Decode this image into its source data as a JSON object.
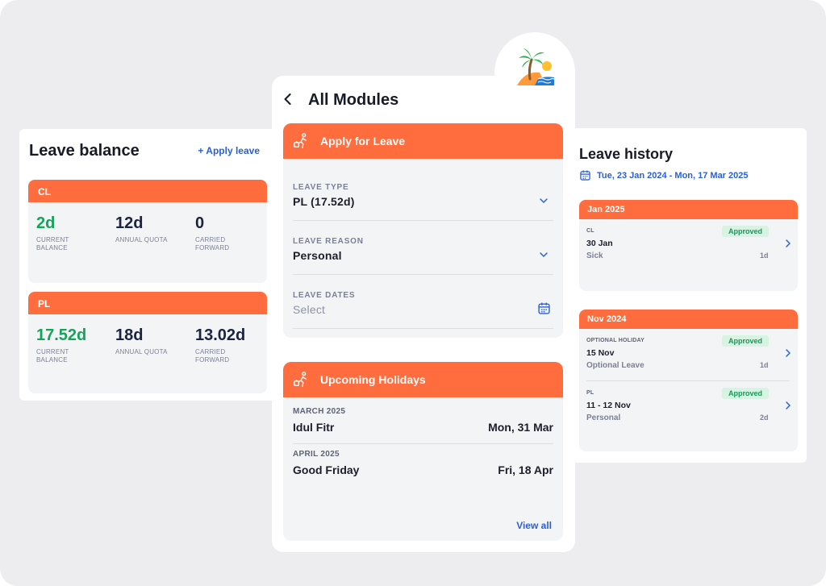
{
  "balance": {
    "title": "Leave balance",
    "apply_label": "+ Apply leave",
    "cards": [
      {
        "code": "CL",
        "current": "2d",
        "current_label": "CURRENT BALANCE",
        "quota": "12d",
        "quota_label": "ANNUAL QUOTA",
        "carried": "0",
        "carried_label": "CARRIED FORWARD"
      },
      {
        "code": "PL",
        "current": "17.52d",
        "current_label": "CURRENT BALANCE",
        "quota": "18d",
        "quota_label": "ANNUAL QUOTA",
        "carried": "13.02d",
        "carried_label": "CARRIED FORWARD"
      }
    ]
  },
  "modules": {
    "title": "All Modules",
    "back_icon": "chevron-left-icon",
    "badge_icon": "palm-beach-icon",
    "apply": {
      "header": "Apply for Leave",
      "icon": "person-luggage-icon",
      "fields": [
        {
          "label": "LEAVE TYPE",
          "value": "PL (17.52d)",
          "control": "chevron-down-icon"
        },
        {
          "label": "LEAVE REASON",
          "value": "Personal",
          "control": "chevron-down-icon"
        },
        {
          "label": "LEAVE DATES",
          "placeholder": "Select",
          "control": "calendar-icon"
        }
      ]
    },
    "holidays": {
      "header": "Upcoming Holidays",
      "icon": "person-luggage-icon",
      "sections": [
        {
          "month": "MARCH 2025",
          "name": "Idul Fitr",
          "date": "Mon, 31 Mar"
        },
        {
          "month": "APRIL 2025",
          "name": "Good Friday",
          "date": "Fri, 18 Apr"
        }
      ],
      "view_all": "View all"
    }
  },
  "history": {
    "title": "Leave history",
    "range": "Tue, 23 Jan 2024 - Mon, 17 Mar 2025",
    "groups": [
      {
        "month": "Jan 2025",
        "items": [
          {
            "type": "CL",
            "date": "30 Jan",
            "reason": "Sick",
            "status": "Approved",
            "duration": "1d"
          }
        ]
      },
      {
        "month": "Nov 2024",
        "items": [
          {
            "type": "OPTIONAL HOLIDAY",
            "date": "15 Nov",
            "reason": "Optional Leave",
            "status": "Approved",
            "duration": "1d"
          },
          {
            "type": "PL",
            "date": "11 - 12 Nov",
            "reason": "Personal",
            "status": "Approved",
            "duration": "2d"
          }
        ]
      }
    ]
  },
  "colors": {
    "accent": "#ff6c3e",
    "link": "#2a5fd6",
    "positive": "#14a35a",
    "approved_bg": "#d7f3e2"
  }
}
